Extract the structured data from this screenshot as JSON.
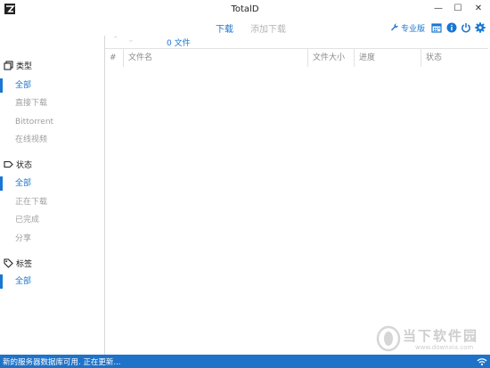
{
  "window": {
    "title": "TotalD",
    "minimize": "—",
    "maximize": "☐",
    "close": "✕"
  },
  "toolbar": {
    "tabs": [
      {
        "label": "下载",
        "active": true
      },
      {
        "label": "添加下载",
        "active": false
      }
    ],
    "pro_label": "专业版",
    "icons": [
      "wrench-icon",
      "calendar-icon",
      "info-icon",
      "power-icon",
      "gear-icon"
    ]
  },
  "sidebar": {
    "sections": [
      {
        "title": "类型",
        "icon": "type-icon",
        "items": [
          "全部",
          "直接下载",
          "Bittorrent",
          "在线视频"
        ],
        "active_index": 0
      },
      {
        "title": "状态",
        "icon": "status-icon",
        "items": [
          "全部",
          "正在下载",
          "已完成",
          "分享"
        ],
        "active_index": 0
      },
      {
        "title": "标签",
        "icon": "tag-icon",
        "items": [
          "全部"
        ],
        "active_index": 0
      }
    ]
  },
  "list": {
    "file_count": "0 文件",
    "columns": [
      "#",
      "文件名",
      "文件大小",
      "进度",
      "状态"
    ]
  },
  "statusbar": {
    "text": "新的服务器数据库可用. 正在更新..."
  },
  "watermark": {
    "brand": "当下软件园",
    "url": "www.downxia.com"
  },
  "colors": {
    "accent": "#1976d2",
    "statusbar": "#1e73c8",
    "inactive": "#9e9e9e"
  }
}
